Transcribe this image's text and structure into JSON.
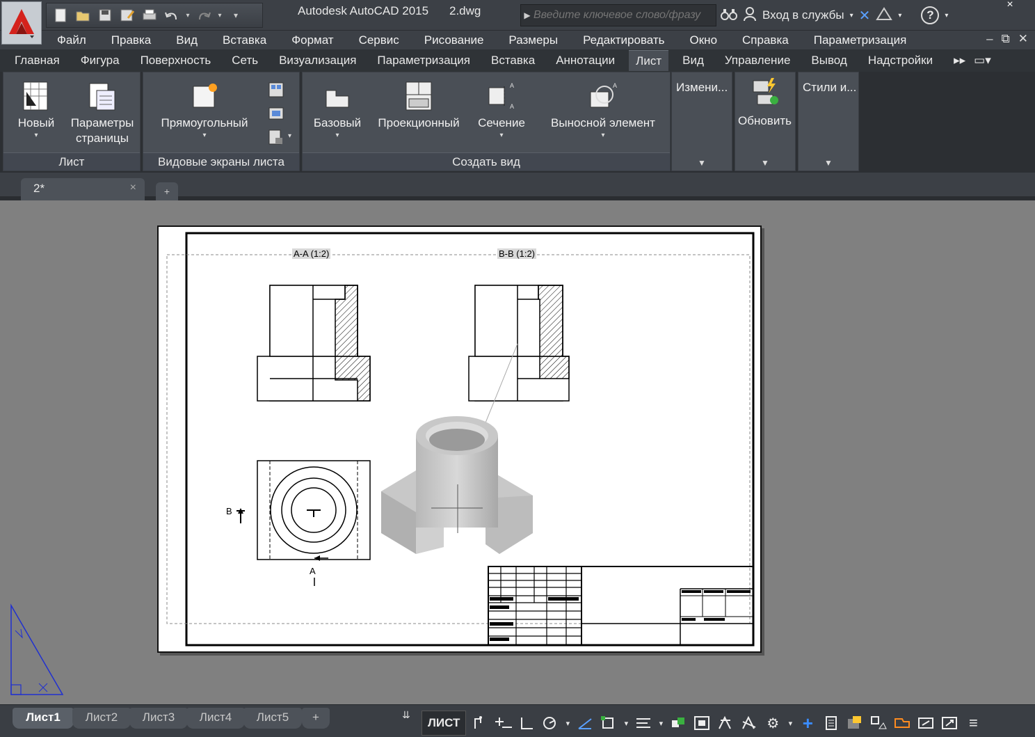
{
  "titlebar": {
    "app_name": "Autodesk AutoCAD 2015",
    "file_name": "2.dwg",
    "search_placeholder": "Введите ключевое слово/фразу",
    "signin_label": "Вход в службы",
    "help_label": "?",
    "close_label": "×"
  },
  "menu": {
    "items": [
      "Файл",
      "Правка",
      "Вид",
      "Вставка",
      "Формат",
      "Сервис",
      "Рисование",
      "Размеры",
      "Редактировать",
      "Окно",
      "Справка",
      "Параметризация"
    ],
    "win_minimize": "–",
    "win_restore": "⧉",
    "win_close": "✕"
  },
  "ribbon_tabs": {
    "items": [
      "Главная",
      "Фигура",
      "Поверхность",
      "Сеть",
      "Визуализация",
      "Параметризация",
      "Вставка",
      "Аннотации",
      "Лист",
      "Вид",
      "Управление",
      "Вывод",
      "Надстройки"
    ],
    "active": "Лист"
  },
  "ribbon": {
    "panel_layout": {
      "title": "Лист",
      "new_label": "Новый",
      "page_setup_label_1": "Параметры",
      "page_setup_label_2": "страницы"
    },
    "panel_viewports": {
      "title": "Видовые экраны листа",
      "rect_label": "Прямоугольный"
    },
    "panel_create_view": {
      "title": "Создать вид",
      "base_label": "Базовый",
      "projected_label": "Проекционный",
      "section_label": "Сечение",
      "detail_label": "Выносной элемент"
    },
    "collapsed_modify": "Измени...",
    "update_label": "Обновить",
    "styles_label": "Стили и..."
  },
  "doc_tabs": {
    "active_name": "2*",
    "close": "×",
    "add": "+"
  },
  "drawing": {
    "section_aa_label": "A-A (1:2)",
    "section_bb_label": "B-B (1:2)",
    "marker_a": "A",
    "marker_b": "B"
  },
  "layout_tabs": {
    "items": [
      "Лист1",
      "Лист2",
      "Лист3",
      "Лист4",
      "Лист5"
    ],
    "active": "Лист1",
    "add": "+"
  },
  "status": {
    "space_label": "ЛИСТ"
  }
}
